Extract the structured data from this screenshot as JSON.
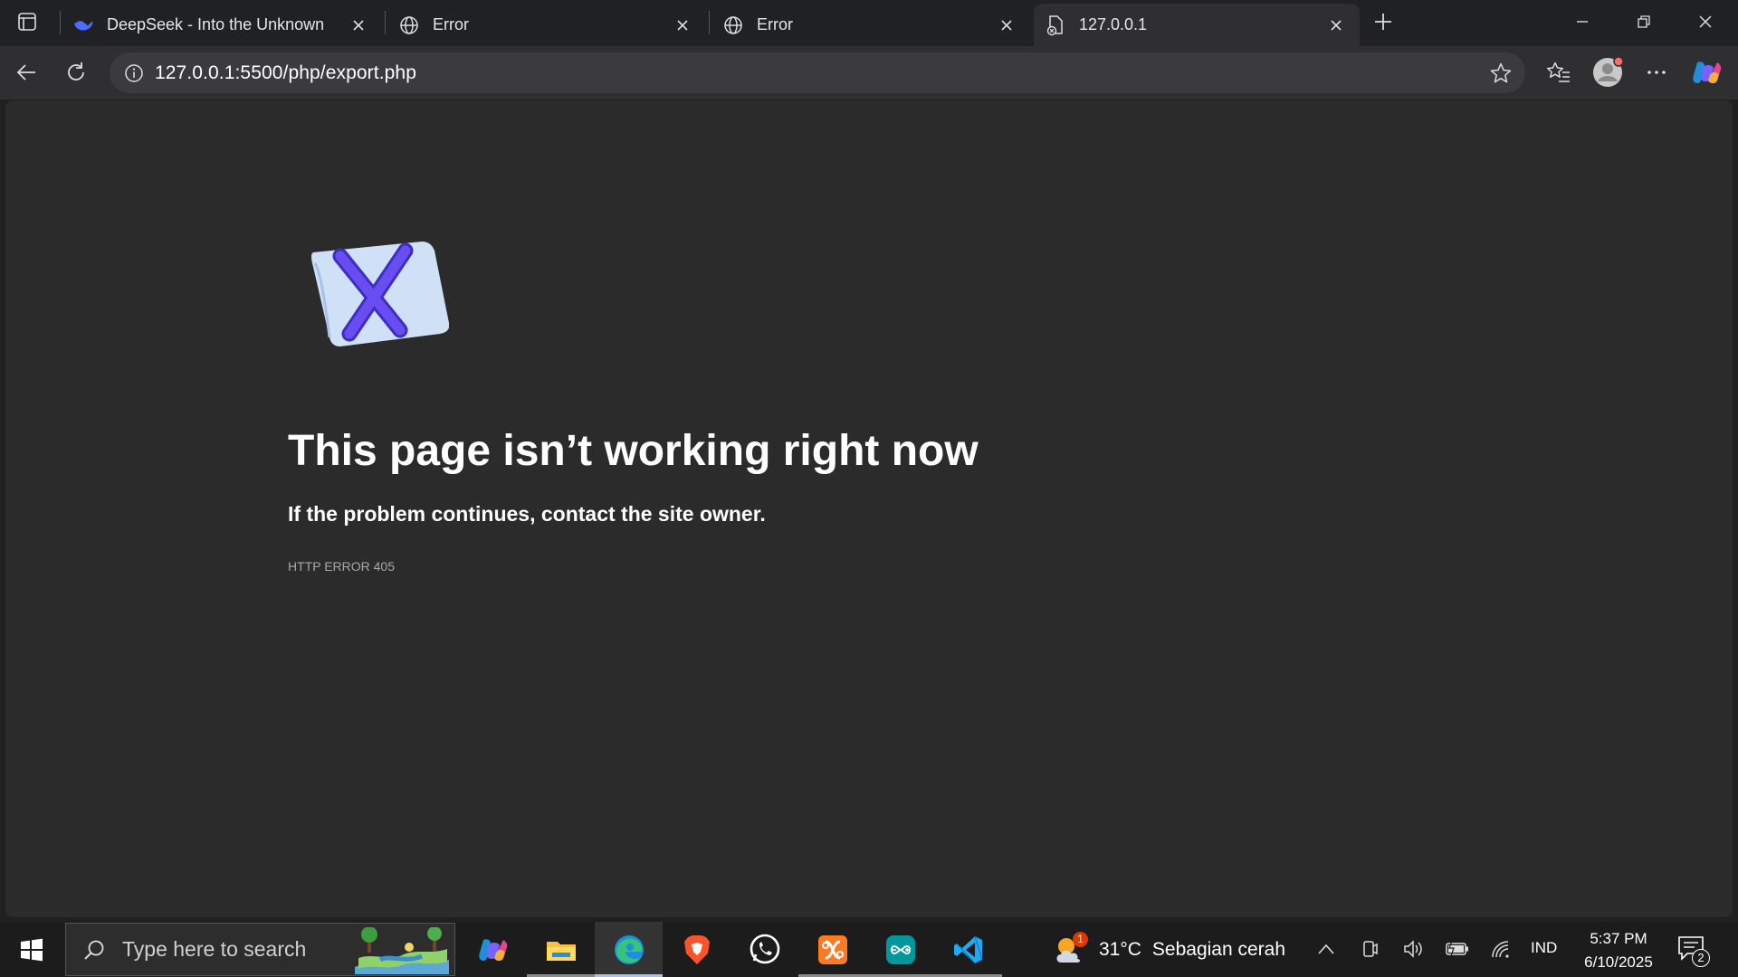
{
  "tabs": [
    {
      "title": "DeepSeek - Into the Unknown",
      "favicon": "deepseek-whale-icon"
    },
    {
      "title": "Error",
      "favicon": "globe-icon"
    },
    {
      "title": "Error",
      "favicon": "globe-icon"
    },
    {
      "title": "127.0.0.1",
      "favicon": "broken-page-icon"
    }
  ],
  "address_bar": {
    "url": "127.0.0.1:5500/php/export.php"
  },
  "error_page": {
    "title": "This page isn’t working right now",
    "subtitle": "If the problem continues, contact the site owner.",
    "code": "HTTP ERROR 405"
  },
  "taskbar": {
    "search_placeholder": "Type here to search",
    "apps": [
      "copilot-icon",
      "file-explorer-icon",
      "edge-icon",
      "brave-icon",
      "whatsapp-icon",
      "xampp-icon",
      "arduino-icon",
      "vscode-icon"
    ],
    "weather": {
      "temp": "31°C",
      "condition": "Sebagian cerah",
      "badge": "1"
    },
    "language": "IND",
    "time": "5:37 PM",
    "date": "6/10/2025",
    "notification_count": "2"
  },
  "colors": {
    "accent": "#a7c2e8",
    "edge_blue": "#1f8fd8",
    "error_x": "#5b3fd8"
  }
}
